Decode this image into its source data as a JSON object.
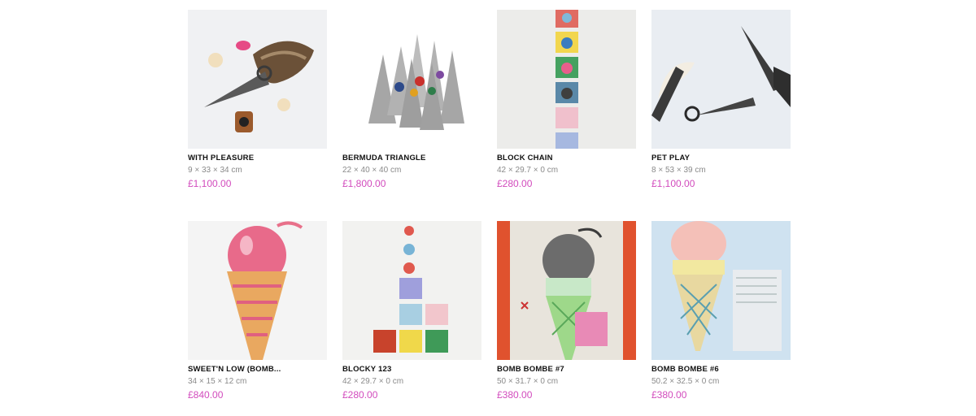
{
  "products": [
    {
      "title": "WITH PLEASURE",
      "dimensions": "9 × 33 × 34 cm",
      "price": "£1,100.00",
      "image": "cone-fox-tail-balls-image"
    },
    {
      "title": "BERMUDA TRIANGLE",
      "dimensions": "22 × 40 × 40 cm",
      "price": "£1,800.00",
      "image": "grey-cones-colored-balls-image"
    },
    {
      "title": "BLOCK CHAIN",
      "dimensions": "42 × 29.7 × 0 cm",
      "price": "£280.00",
      "image": "bomb-squares-column-image"
    },
    {
      "title": "PET PLAY",
      "dimensions": "8 × 53 × 39 cm",
      "price": "£1,100.00",
      "image": "dark-cones-fur-tail-image"
    },
    {
      "title": "SWEET'N LOW (BOMB...",
      "dimensions": "34 × 15 × 12 cm",
      "price": "£840.00",
      "image": "pink-ice-cream-bomb-image"
    },
    {
      "title": "BLOCKY 123",
      "dimensions": "42 × 29.7 × 0 cm",
      "price": "£280.00",
      "image": "blocky-colored-squares-image"
    },
    {
      "title": "BOMB BOMBE #7",
      "dimensions": "50 × 31.7 × 0 cm",
      "price": "£380.00",
      "image": "bomb-cone-collage-image"
    },
    {
      "title": "BOMB BOMBE #6",
      "dimensions": "50.2 × 32.5 × 0 cm",
      "price": "£380.00",
      "image": "ice-cream-cone-collage-image"
    }
  ]
}
